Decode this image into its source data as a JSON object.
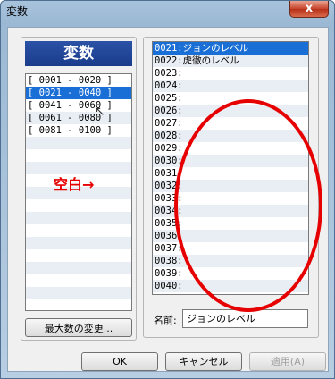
{
  "window": {
    "title": "変数",
    "close_label": "x"
  },
  "left_panel": {
    "header": "変数",
    "ranges": [
      "[ 0001 - 0020 ]",
      "[ 0021 - 0040 ]",
      "[ 0041 - 0060 ]",
      "[ 0061 - 0080 ]",
      "[ 0081 - 0100 ]"
    ],
    "selected_index": 1,
    "max_button": "最大数の変更..."
  },
  "annotation": {
    "blank_label": "空白→",
    "color": "#e60000"
  },
  "variables": [
    "0021:ジョンのレベル",
    "0022:虎徹のレベル",
    "0023:",
    "0024:",
    "0025:",
    "0026:",
    "0027:",
    "0028:",
    "0029:",
    "0030:",
    "0031:",
    "0032:",
    "0033:",
    "0034:",
    "0035:",
    "0036:",
    "0037:",
    "0038:",
    "0039:",
    "0040:"
  ],
  "name_field": {
    "label": "名前:",
    "value": "ジョンのレベル"
  },
  "buttons": {
    "ok": "OK",
    "cancel": "キャンセル",
    "apply": "適用(A)"
  },
  "colors": {
    "selection": "#1a6fd6",
    "header_bg": "#1a3c8b"
  }
}
